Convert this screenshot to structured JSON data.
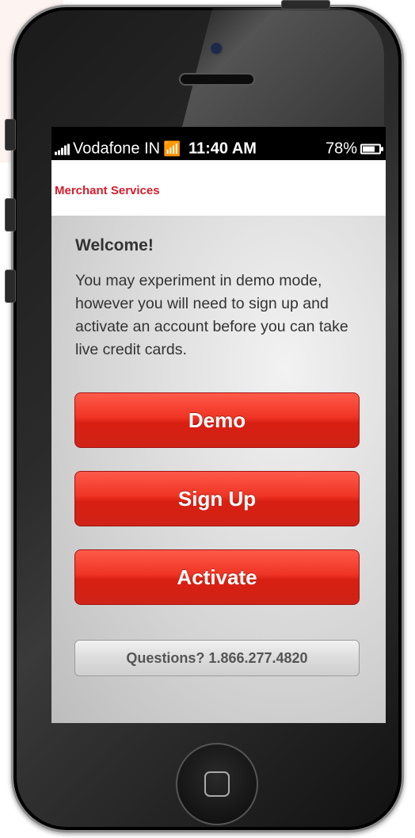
{
  "status_bar": {
    "carrier": "Vodafone IN",
    "time": "11:40 AM",
    "battery": "78%"
  },
  "header": {
    "title": "Merchant Services"
  },
  "main": {
    "heading": "Welcome!",
    "message": "You may experiment in demo mode, however you will need to sign up and activate an account before you can take live credit cards.",
    "buttons": {
      "demo": "Demo",
      "sign_up": "Sign Up",
      "activate": "Activate"
    },
    "questions": "Questions? 1.866.277.4820"
  },
  "colors": {
    "brand_red": "#d51d2b",
    "button_red": "#e8301f"
  },
  "icons": {
    "signal": "signal-icon",
    "wifi": "wifi-icon",
    "battery": "battery-icon"
  }
}
